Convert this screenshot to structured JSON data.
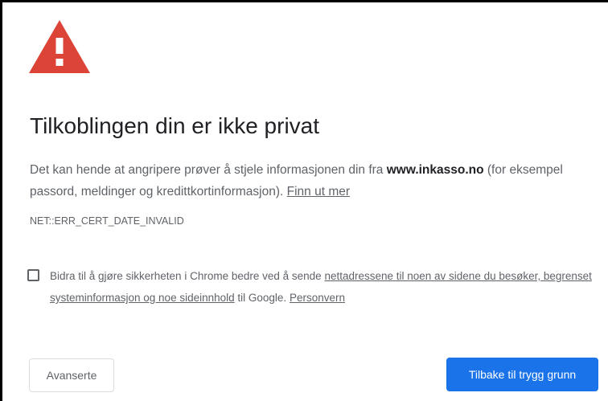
{
  "interstitial": {
    "icon": "warning-triangle-icon",
    "icon_color": "#db4437",
    "heading": "Tilkoblingen din er ikke privat",
    "explanation": {
      "before_host": "Det kan hende at angripere prøver å stjele informasjonen din fra ",
      "host": "www.inkasso.no",
      "after_host": " (for eksempel passord, meldinger og kredittkortinformasjon). ",
      "learn_more_link": "Finn ut mer"
    },
    "error_code": "NET::ERR_CERT_DATE_INVALID",
    "opt_in": {
      "checked": false,
      "text_before": "Bidra til å gjøre sikkerheten i Chrome bedre ved å sende ",
      "link_data": "nettadressene til noen av sidene du besøker, begrenset systeminformasjon og noe sideinnhold",
      "text_middle": " til Google. ",
      "privacy_link": "Personvern"
    },
    "buttons": {
      "advanced_label": "Avanserte",
      "back_to_safety_label": "Tilbake til trygg grunn",
      "primary_color": "#1a73e8"
    }
  }
}
